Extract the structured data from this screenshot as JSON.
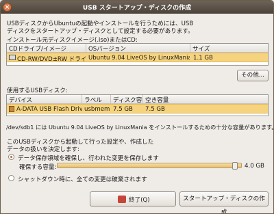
{
  "window": {
    "title": "USB スタートアップ・ディスクの作成",
    "close_glyph": "×"
  },
  "intro": {
    "line1": "USBディスクからUbuntuの起動やインストールを行うためには、USB",
    "line2": "ディスクをスタートアップ・ディスクとして設定する必要があります。"
  },
  "source": {
    "label": "インストール元ディスクイメージ(.iso)またはCD:",
    "columns": [
      "CDドライブ/イメージ",
      "OSバージョン",
      "サイズ"
    ],
    "rows": [
      {
        "device": "CD-RW/DVD±RW ドライブ",
        "os": "Ubuntu 9.04 LiveOS by LinuxMania",
        "size": "1.1 GB",
        "icon": "cd-drive-icon"
      }
    ],
    "other_button": "その他..."
  },
  "target": {
    "label": "使用するUSBディスク:",
    "columns": [
      "デバイス",
      "ラベル",
      "ディスク容量",
      "空き容量"
    ],
    "rows": [
      {
        "device": "A-DATA USB Flash Drive",
        "label": "usbmem",
        "capacity": "7.5 GB",
        "free": "7.5 GB",
        "icon": "usb-drive-icon"
      }
    ],
    "status": "/dev/sdb1 には Ubuntu 9.04 LiveOS by LinuxMania をインストールするための十分な容量があります。"
  },
  "persistence": {
    "question_line1": "このUSBディスクから起動して行った設定や、作成した",
    "question_line2": "データの扱いを決定します:",
    "option_save": "データ保存領域を確保し、行われた変更を保存します",
    "size_label": "確保する容量:",
    "size_value": "4.0 GB",
    "size_fraction": 0.98,
    "option_discard": "シャットダウン時に、全ての変更は破棄されます",
    "selected": "save"
  },
  "buttons": {
    "quit": "終了(Q)",
    "create": "スタートアップ・ディスクの作成"
  },
  "colors": {
    "selection": "#f6d47f",
    "accent": "#c0652a",
    "titlebar": "#5a5047"
  }
}
